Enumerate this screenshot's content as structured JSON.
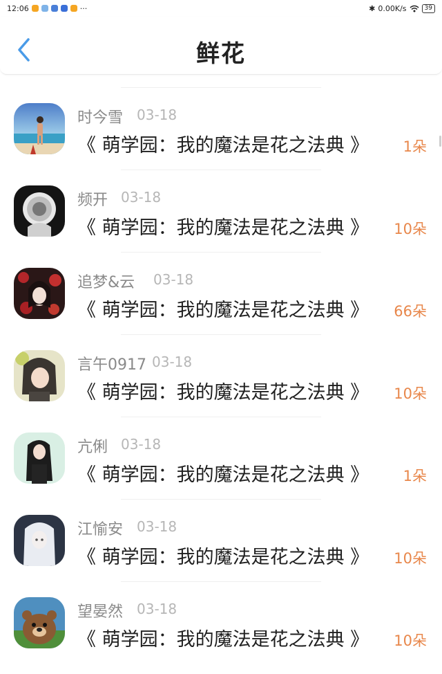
{
  "status_bar": {
    "time": "12:06",
    "more": "···",
    "network_speed": "0.00K/s",
    "battery": "39"
  },
  "header": {
    "title": "鲜花",
    "back_icon": "chevron-left-icon"
  },
  "items": [
    {
      "name": "时今雪",
      "date": "03-18",
      "book": "《 萌学园：我的魔法是花之法典 》",
      "count": "1朵",
      "avatar_icon": "beach-photo-avatar"
    },
    {
      "name": "频开",
      "date": "03-18",
      "book": "《 萌学园：我的魔法是花之法典 》",
      "count": "10朵",
      "avatar_icon": "dark-circle-avatar"
    },
    {
      "name": "追梦&云",
      "date": "03-18",
      "book": "《 萌学园：我的魔法是花之法典 》",
      "count": "66朵",
      "avatar_icon": "red-flower-girl-avatar"
    },
    {
      "name": "言午0917",
      "date": "03-18",
      "book": "《 萌学园：我的魔法是花之法典 》",
      "count": "10朵",
      "avatar_icon": "anime-girl-avatar"
    },
    {
      "name": "亢俐",
      "date": "03-18",
      "book": "《 萌学园：我的魔法是花之法典 》",
      "count": "1朵",
      "avatar_icon": "long-hair-girl-avatar"
    },
    {
      "name": "江愉安",
      "date": "03-18",
      "book": "《 萌学园：我的魔法是花之法典 》",
      "count": "10朵",
      "avatar_icon": "white-hair-girl-avatar"
    },
    {
      "name": "望晏然",
      "date": "03-18",
      "book": "《 萌学园：我的魔法是花之法典 》",
      "count": "10朵",
      "avatar_icon": "cartoon-bear-avatar"
    }
  ],
  "colors": {
    "accent": "#4a9be8",
    "count": "#e8874b",
    "name": "#8a8a8a",
    "date": "#b6b6b6"
  }
}
